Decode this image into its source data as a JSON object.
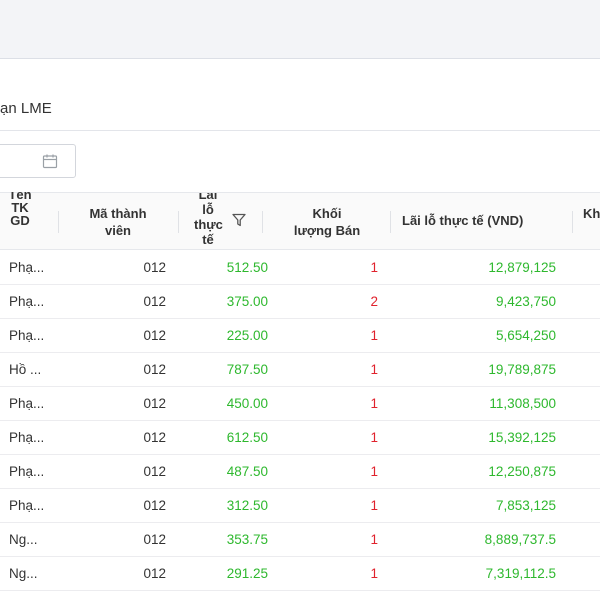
{
  "page": {
    "title": "ạn LME"
  },
  "filters": {
    "date_value": "",
    "date_placeholder": ""
  },
  "table": {
    "headers": {
      "name": "Tên TK GD",
      "member": "Mã thành viên",
      "actual": "Lãi lỗ thực tế",
      "sell_volume": "Khối lượng Bán",
      "actual_vnd": "Lãi lỗ thực tế (VND)",
      "next": "Kh"
    },
    "rows": [
      {
        "name": "Phạ...",
        "member": "012",
        "actual": "512.50",
        "sell": "1",
        "vnd": "12,879,125"
      },
      {
        "name": "Phạ...",
        "member": "012",
        "actual": "375.00",
        "sell": "2",
        "vnd": "9,423,750"
      },
      {
        "name": "Phạ...",
        "member": "012",
        "actual": "225.00",
        "sell": "1",
        "vnd": "5,654,250"
      },
      {
        "name": "Hồ ...",
        "member": "012",
        "actual": "787.50",
        "sell": "1",
        "vnd": "19,789,875"
      },
      {
        "name": "Phạ...",
        "member": "012",
        "actual": "450.00",
        "sell": "1",
        "vnd": "11,308,500"
      },
      {
        "name": "Phạ...",
        "member": "012",
        "actual": "612.50",
        "sell": "1",
        "vnd": "15,392,125"
      },
      {
        "name": "Phạ...",
        "member": "012",
        "actual": "487.50",
        "sell": "1",
        "vnd": "12,250,875"
      },
      {
        "name": "Phạ...",
        "member": "012",
        "actual": "312.50",
        "sell": "1",
        "vnd": "7,853,125"
      },
      {
        "name": "Ng...",
        "member": "012",
        "actual": "353.75",
        "sell": "1",
        "vnd": "8,889,737.5"
      },
      {
        "name": "Ng...",
        "member": "012",
        "actual": "291.25",
        "sell": "1",
        "vnd": "7,319,112.5"
      }
    ]
  },
  "icons": {
    "calendar": "calendar-icon",
    "filter": "filter-icon"
  },
  "colors": {
    "profit": "#2eb82e",
    "sell": "#e0222d",
    "header_bg": "#fafafa",
    "topbar_bg": "#f3f4f7"
  }
}
